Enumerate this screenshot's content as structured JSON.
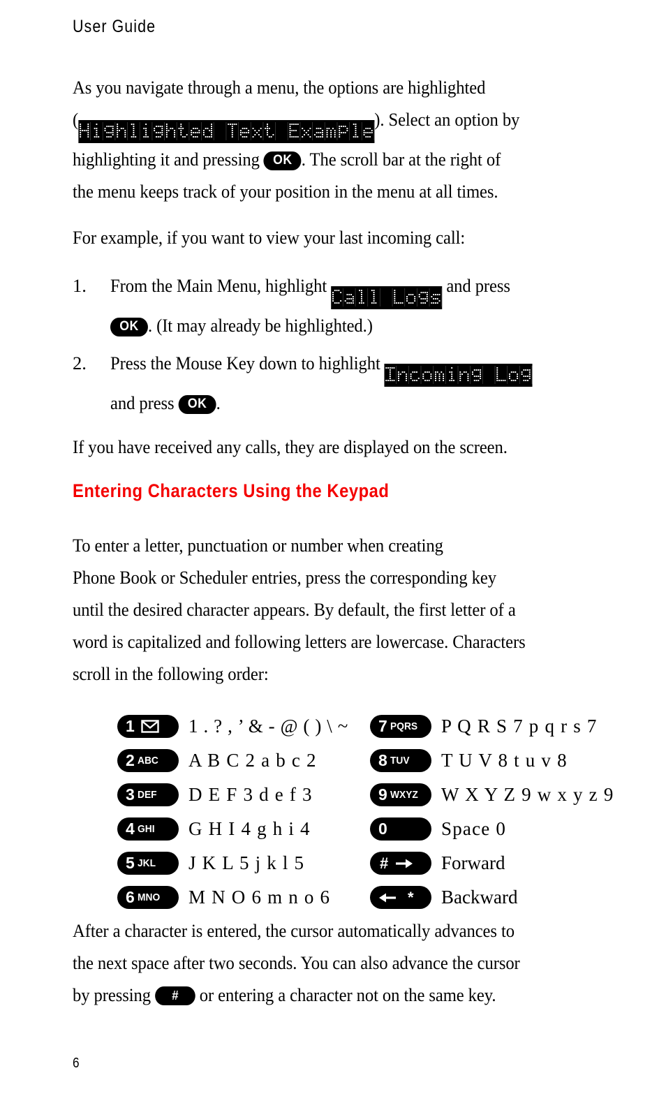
{
  "page": {
    "running_head": "User Guide",
    "page_number": "6",
    "accent_color": "#F40000"
  },
  "paragraphs": {
    "intro_1": "As you navigate through a menu, the options are highlighted",
    "intro_lcd_open": "(",
    "intro_lcd_text": "Highlighted Text Example",
    "intro_2": "). Select an option by",
    "intro_3": "highlighting it and pressing",
    "intro_4": ". The scroll bar at the right of",
    "intro_5": "the menu keeps track of your position in the menu at all times.",
    "example_intro": "For example, if you want to view your last incoming call:",
    "after_steps": "If you have received any calls, they are displayed on the screen.",
    "keypad_intro_1": "To enter a letter, punctuation or number when creating",
    "keypad_intro_2": "Phone Book or Scheduler entries, press the corresponding key",
    "keypad_intro_3": "until the desired character appears. By default, the first letter of a",
    "keypad_intro_4": "word is capitalized and following letters are lowercase. Characters",
    "keypad_intro_5": "scroll in the following order:",
    "closing_1": "After a character is entered, the cursor automatically advances to",
    "closing_2": "the next space after two seconds. You can also advance the cursor",
    "closing_3": "by pressing",
    "closing_4": "or entering a character not on the same key."
  },
  "steps": [
    {
      "number": "1.",
      "text_before": "From the Main Menu, highlight",
      "lcd_text": "Call Logs",
      "text_after": "and press",
      "text_line2": ". (It may already be highlighted.)"
    },
    {
      "number": "2.",
      "text_before": "Press the Mouse Key down to highlight",
      "lcd_text": "Incoming Log",
      "text_after": "",
      "text_line2_before": "and press",
      "text_line2_after": "."
    }
  ],
  "buttons": {
    "ok_label": "OK",
    "hash_label": "#"
  },
  "section_heading": "Entering Characters Using the Keypad",
  "keypad": {
    "left_column": [
      {
        "digit": "1",
        "letters": "",
        "icon": "envelope-icon",
        "chars": "1 . ? , ’ & - @ ( ) \\ ~"
      },
      {
        "digit": "2",
        "letters": "ABC",
        "icon": "",
        "chars": "A B C 2 a b c 2"
      },
      {
        "digit": "3",
        "letters": "DEF",
        "icon": "",
        "chars": "D E F 3 d e f 3"
      },
      {
        "digit": "4",
        "letters": "GHI",
        "icon": "",
        "chars": "G H I 4 g h i 4"
      },
      {
        "digit": "5",
        "letters": "JKL",
        "icon": "",
        "chars": "J K L 5 j k l 5"
      },
      {
        "digit": "6",
        "letters": "MNO",
        "icon": "",
        "chars": "M N O 6 m n o 6"
      }
    ],
    "right_column": [
      {
        "digit": "7",
        "letters": "PQRS",
        "icon": "",
        "chars": "P Q R S 7 p q r s 7"
      },
      {
        "digit": "8",
        "letters": "TUV",
        "icon": "",
        "chars": "T U V 8 t u v 8"
      },
      {
        "digit": "9",
        "letters": "WXYZ",
        "icon": "",
        "chars": "W X Y Z 9 w x y z 9"
      },
      {
        "digit": "0",
        "letters": "",
        "icon": "",
        "chars": "Space  0"
      },
      {
        "digit": "#",
        "letters": "",
        "icon": "arrow-right-icon",
        "chars": "Forward"
      },
      {
        "digit": "*",
        "letters": "",
        "icon": "arrow-left-icon",
        "chars": "Backward"
      }
    ]
  }
}
